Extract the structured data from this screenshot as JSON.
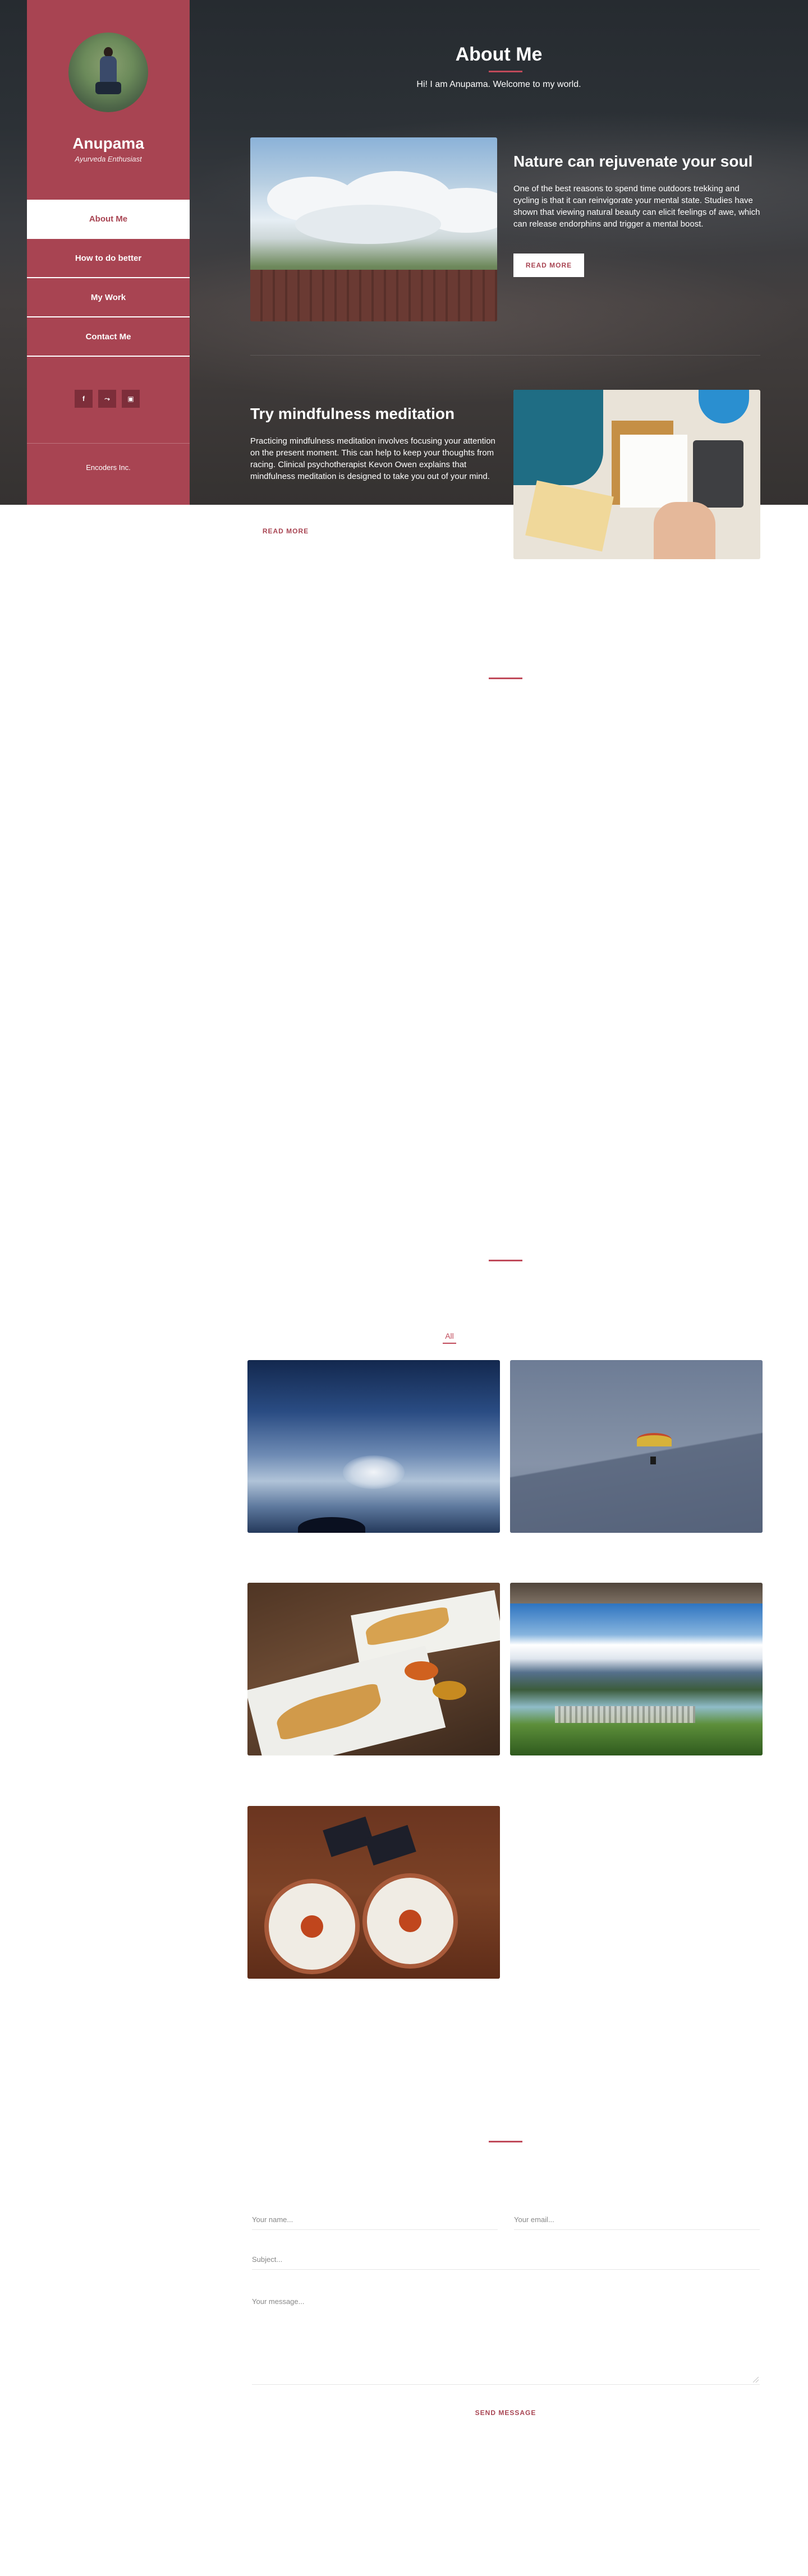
{
  "sidebar": {
    "name": "Anupama",
    "role": "Ayurveda Enthusiast",
    "nav": [
      {
        "label": "About Me",
        "active": true
      },
      {
        "label": "How to do better",
        "active": false
      },
      {
        "label": "My Work",
        "active": false
      },
      {
        "label": "Contact Me",
        "active": false
      }
    ],
    "social": [
      {
        "icon": "facebook-icon",
        "glyph": "f"
      },
      {
        "icon": "twitter-icon",
        "glyph": "⤳"
      },
      {
        "icon": "instagram-icon",
        "glyph": "▣"
      }
    ],
    "footer": "Encoders Inc."
  },
  "hero": {
    "title": "About Me",
    "subtitle": "Hi! I am Anupama. Welcome to my world."
  },
  "articles": [
    {
      "title": "Nature can rejuvenate your soul",
      "body": "One of the best reasons to spend time outdoors trekking and cycling is that it can reinvigorate your mental state. Studies have shown that viewing natural beauty can elicit feelings of awe, which can release endorphins and trigger a mental boost.",
      "button": "READ MORE"
    },
    {
      "title": "Try mindfulness meditation",
      "body": "Practicing mindfulness meditation involves focusing your attention on the present moment. This can help to keep your thoughts from racing. Clinical psychotherapist Kevon Owen explains that mindfulness meditation is designed to take you out of your mind.",
      "button": "READ MORE"
    }
  ],
  "gallery": {
    "filter": "All",
    "images": [
      "sky-photo",
      "paraglider-photo",
      "samosa-photo",
      "lake-city-photo",
      "momo-photo"
    ]
  },
  "contact": {
    "name_placeholder": "Your name...",
    "email_placeholder": "Your email...",
    "subject_placeholder": "Subject...",
    "message_placeholder": "Your message...",
    "send_label": "SEND MESSAGE"
  },
  "colors": {
    "brand": "#a84452",
    "accent": "#c04a5a",
    "hero_dark": "#2c3136"
  }
}
